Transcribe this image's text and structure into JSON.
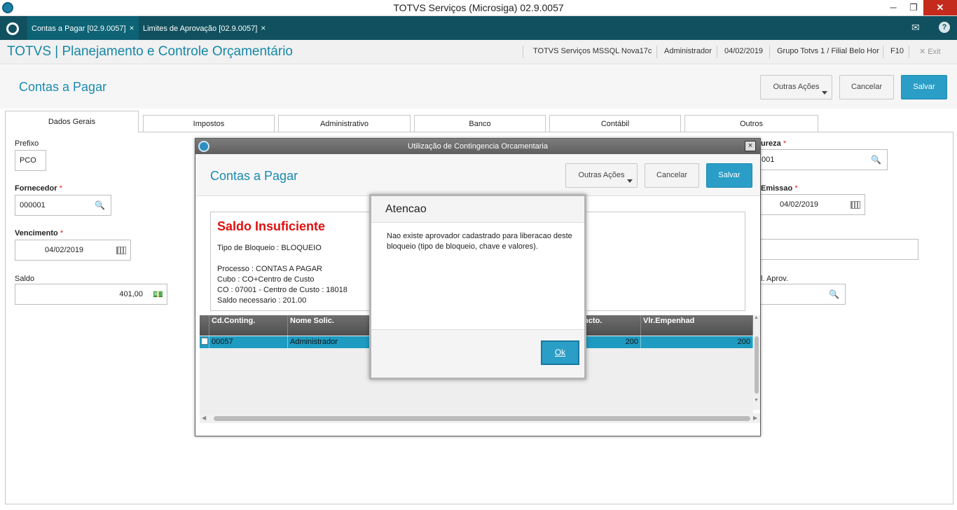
{
  "window": {
    "title": "TOTVS Serviços (Microsiga) 02.9.0057",
    "minimize": "─",
    "restore": "❐",
    "close": "✕"
  },
  "tabs": [
    {
      "label": "Contas a Pagar [02.9.0057]",
      "close": "×"
    },
    {
      "label": "Limites de Aprovação [02.9.0057]",
      "close": "×"
    }
  ],
  "header": {
    "brand": "TOTVS | Planejamento e Controle Orçamentário",
    "server": "TOTVS Serviços MSSQL Nova17c",
    "user": "Administrador",
    "date": "04/02/2019",
    "branch": "Grupo Totvs 1 / Filial Belo Hor",
    "shortcut": "F10",
    "exit_icon": "✕",
    "exit": "Exit"
  },
  "page": {
    "title": "Contas a Pagar",
    "other_actions": "Outras Ações",
    "cancel": "Cancelar",
    "save": "Salvar"
  },
  "folders": [
    "Dados Gerais",
    "Impostos",
    "Administrativo",
    "Banco",
    "Contábil",
    "Outros"
  ],
  "form": {
    "prefixo_label": "Prefixo",
    "prefixo_value": "PCO",
    "fornecedor_label": "Fornecedor",
    "fornecedor_value": "000001",
    "vencimento_label": "Vencimento",
    "vencimento_value": "04/02/2019",
    "saldo_label": "Saldo",
    "saldo_value": "401,00",
    "natureza_label": "ureza",
    "natureza_value": "001",
    "emissao_label": "Emissao",
    "emissao_value": "04/02/2019",
    "aprov_label": "l. Aprov.",
    "required_mark": "*"
  },
  "dialog1": {
    "title": "Utilização de Contingencia Orcamentaria",
    "close": "×",
    "page_title": "Contas a Pagar",
    "other_actions": "Outras Ações",
    "cancel": "Cancelar",
    "save": "Salvar",
    "heading": "Saldo Insuficiente",
    "lines": [
      "Tipo de Bloqueio : BLOQUEIO",
      "Processo : CONTAS A PAGAR",
      "Cubo : CO+Centro de Custo",
      "CO : 07001 - Centro de Custo : 18018",
      "Saldo necessario : 201.00"
    ],
    "grid_headers": [
      "Cd.Conting.",
      "Nome Solic.",
      "ncto.",
      "Vlr.Empenhad"
    ],
    "grid_row": [
      "00057",
      "Administrador",
      "200",
      "200"
    ]
  },
  "dialog2": {
    "title": "Atencao",
    "message": "Nao existe aprovador cadastrado para liberacao deste bloqueio (tipo de bloqueio, chave e valores).",
    "ok": "Ok"
  },
  "icons": {
    "search": "🔍",
    "mail": "✉",
    "help": "?",
    "money": "💵",
    "scroll_left": "◀",
    "scroll_right": "▶",
    "scroll_up": "▲",
    "scroll_down": "▼"
  }
}
